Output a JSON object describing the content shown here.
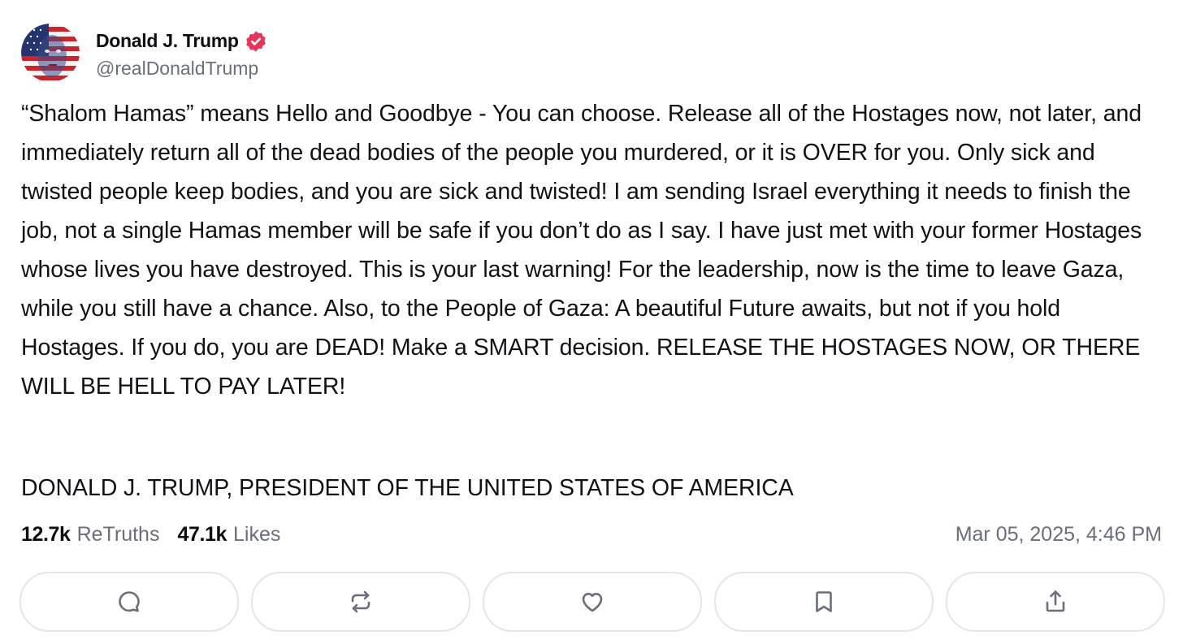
{
  "author": {
    "display_name": "Donald J. Trump",
    "handle": "@realDonaldTrump",
    "verified": true,
    "verified_color": "#e8345a"
  },
  "post": {
    "text": "“Shalom Hamas” means Hello and Goodbye - You can choose. Release all of the Hostages now, not later, and immediately return all of the dead bodies of the people you murdered, or it is OVER for you. Only sick and twisted people keep bodies, and you are sick and twisted! I am sending Israel everything it needs to finish the job, not a single Hamas member will be safe if you don’t do as I say. I have just met with your former Hostages whose lives you have destroyed. This is your last warning! For the leadership, now is the time to leave Gaza, while you still have a chance. Also, to the People of Gaza: A beautiful Future awaits, but not if you hold Hostages. If you do, you are DEAD! Make a SMART decision. RELEASE THE HOSTAGES NOW, OR THERE WILL BE HELL TO PAY LATER!",
    "signature": "DONALD J. TRUMP, PRESIDENT OF THE UNITED STATES OF AMERICA"
  },
  "stats": {
    "retruths_count": "12.7k",
    "retruths_label": "ReTruths",
    "likes_count": "47.1k",
    "likes_label": "Likes"
  },
  "timestamp": "Mar 05, 2025, 4:46 PM",
  "actions": [
    {
      "name": "reply",
      "icon": "comment-icon"
    },
    {
      "name": "retruth",
      "icon": "repost-icon"
    },
    {
      "name": "like",
      "icon": "heart-icon"
    },
    {
      "name": "bookmark",
      "icon": "bookmark-icon"
    },
    {
      "name": "share",
      "icon": "share-icon"
    }
  ],
  "colors": {
    "text": "#0f0f14",
    "muted": "#6b6f7b",
    "border": "#e5e6ea",
    "icon": "#6b6f7b"
  }
}
